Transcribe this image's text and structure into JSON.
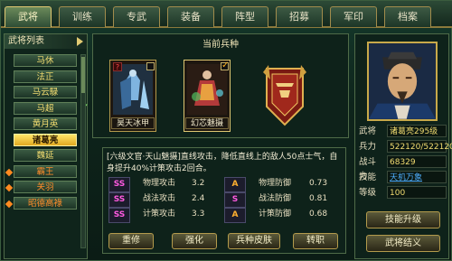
{
  "tabs": [
    "武将",
    "训练",
    "专武",
    "装备",
    "阵型",
    "招募",
    "军印",
    "档案"
  ],
  "active_tab": 0,
  "general_list": {
    "title": "武将列表",
    "items": [
      {
        "name": "马休",
        "color": "yellow",
        "marker": "",
        "selected": false
      },
      {
        "name": "法正",
        "color": "yellow",
        "marker": "",
        "selected": false
      },
      {
        "name": "马云騄",
        "color": "yellow",
        "marker": "",
        "selected": false
      },
      {
        "name": "马超",
        "color": "yellow",
        "marker": "check",
        "selected": false
      },
      {
        "name": "黄月英",
        "color": "yellow",
        "marker": "",
        "selected": false
      },
      {
        "name": "诸葛亮",
        "color": "dark",
        "marker": "",
        "selected": true
      },
      {
        "name": "魏延",
        "color": "yellow",
        "marker": "",
        "selected": false
      },
      {
        "name": "霸王",
        "color": "orange",
        "marker": "diamond",
        "selected": false
      },
      {
        "name": "关羽",
        "color": "orange",
        "marker": "diamond",
        "selected": false
      },
      {
        "name": "昭德高祿",
        "color": "orange",
        "marker": "diamond",
        "selected": false
      }
    ]
  },
  "soldiers": {
    "title": "当前兵种",
    "cards": [
      {
        "label": "昊天冰甲",
        "question": true,
        "checked": false
      },
      {
        "label": "幻芯魅摄",
        "question": false,
        "checked": true
      },
      {
        "label": "",
        "question": false,
        "checked": false
      }
    ]
  },
  "description": "[六级文官·天山魅摄]直线攻击，降低直线上的敌人50点士气，自身提升40%计策攻击2回合。",
  "stats": [
    {
      "grade": "SS",
      "name": "物理攻击",
      "value": "3.2",
      "grade2": "A",
      "name2": "物理防御",
      "value2": "0.73"
    },
    {
      "grade": "SS",
      "name": "战法攻击",
      "value": "2.4",
      "grade2": "S",
      "name2": "战法防御",
      "value2": "0.81"
    },
    {
      "grade": "SS",
      "name": "计策攻击",
      "value": "3.3",
      "grade2": "A",
      "name2": "计策防御",
      "value2": "0.68"
    }
  ],
  "buttons": [
    "重修",
    "强化",
    "兵种皮肤",
    "转职"
  ],
  "general_info": {
    "rows": [
      {
        "label": "武将",
        "value": "诸葛亮295级"
      },
      {
        "label": "兵力",
        "value": "522120/522120"
      },
      {
        "label": "战斗力",
        "value": "68329"
      },
      {
        "label": "技能",
        "value": "天机万象"
      },
      {
        "label": "等级",
        "value": "100"
      }
    ],
    "upgrade_button": "技能升级",
    "bond_button": "武将结义"
  }
}
